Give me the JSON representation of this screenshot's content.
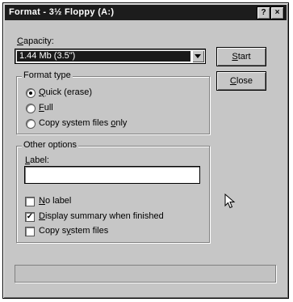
{
  "window": {
    "title": "Format - 3½ Floppy (A:)",
    "help_glyph": "?",
    "close_glyph": "×"
  },
  "capacity": {
    "label_pre": "",
    "label_hot": "C",
    "label_post": "apacity:",
    "selected": "1.44 Mb (3.5\")"
  },
  "buttons": {
    "start": {
      "hot": "S",
      "rest": "tart"
    },
    "close": {
      "hot": "C",
      "rest": "lose"
    }
  },
  "format_type": {
    "legend": "Format type",
    "options": [
      {
        "hot": "Q",
        "rest": "uick (erase)",
        "selected": true
      },
      {
        "hot": "F",
        "rest": "ull",
        "selected": false
      },
      {
        "pre": "Copy system files ",
        "hot": "o",
        "rest": "nly",
        "selected": false
      }
    ]
  },
  "other_options": {
    "legend": "Other options",
    "label_field": {
      "hot": "L",
      "rest": "abel:",
      "value": ""
    },
    "checkboxes": [
      {
        "hot": "N",
        "rest": "o label",
        "checked": false
      },
      {
        "hot": "D",
        "rest": "isplay summary when finished",
        "checked": true
      },
      {
        "pre": "Copy s",
        "hot": "y",
        "rest": "stem files",
        "checked": false
      }
    ]
  }
}
